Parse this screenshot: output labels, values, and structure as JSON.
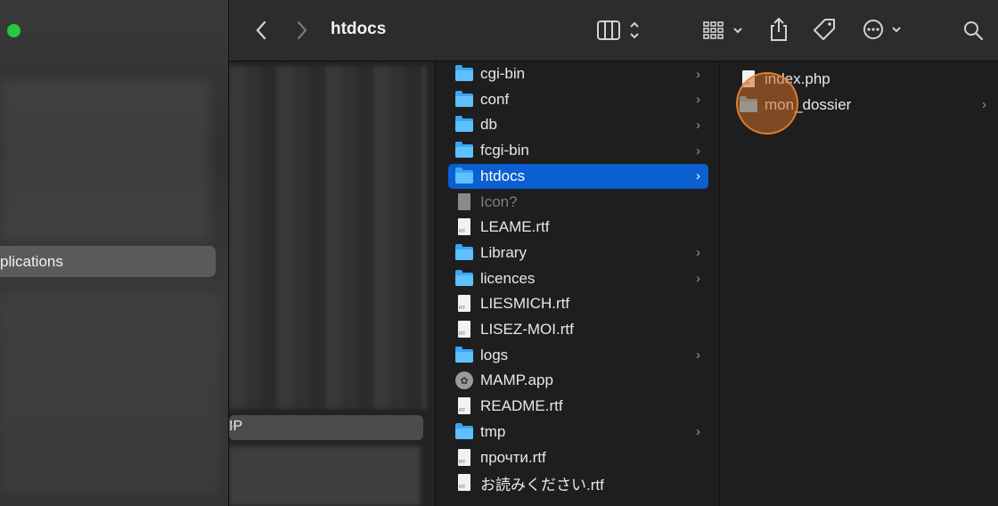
{
  "window": {
    "title": "htdocs"
  },
  "sidebar": {
    "selected_label": "plications"
  },
  "column1": {
    "selected_label": "IP"
  },
  "column2": {
    "items": [
      {
        "label": "cgi-bin",
        "kind": "folder",
        "chevron": true
      },
      {
        "label": "conf",
        "kind": "folder",
        "chevron": true
      },
      {
        "label": "db",
        "kind": "folder",
        "chevron": true
      },
      {
        "label": "fcgi-bin",
        "kind": "folder",
        "chevron": true
      },
      {
        "label": "htdocs",
        "kind": "folder",
        "chevron": true,
        "selected": true
      },
      {
        "label": "Icon?",
        "kind": "file-gray",
        "chevron": false,
        "dim": true
      },
      {
        "label": "LEAME.rtf",
        "kind": "file",
        "chevron": false
      },
      {
        "label": "Library",
        "kind": "folder",
        "chevron": true
      },
      {
        "label": "licences",
        "kind": "folder",
        "chevron": true
      },
      {
        "label": "LIESMICH.rtf",
        "kind": "file",
        "chevron": false
      },
      {
        "label": "LISEZ-MOI.rtf",
        "kind": "file",
        "chevron": false
      },
      {
        "label": "logs",
        "kind": "folder",
        "chevron": true
      },
      {
        "label": "MAMP.app",
        "kind": "app",
        "chevron": false
      },
      {
        "label": "README.rtf",
        "kind": "file",
        "chevron": false
      },
      {
        "label": "tmp",
        "kind": "folder",
        "chevron": true
      },
      {
        "label": "прочти.rtf",
        "kind": "file",
        "chevron": false
      },
      {
        "label": "お読みください.rtf",
        "kind": "file",
        "chevron": false
      }
    ]
  },
  "column3": {
    "items": [
      {
        "label": "index.php",
        "kind": "php",
        "chevron": false
      },
      {
        "label": "mon_dossier",
        "kind": "folder",
        "chevron": true
      }
    ]
  },
  "colors": {
    "selection": "#0a5fd1",
    "folder": "#3aa7f0",
    "toolbar": "#2c2c2c"
  },
  "icons": {
    "toolbar": [
      "chevron-left-icon",
      "chevron-right-icon",
      "column-view-icon",
      "group-icon",
      "share-icon",
      "tag-icon",
      "more-icon",
      "search-icon"
    ]
  }
}
